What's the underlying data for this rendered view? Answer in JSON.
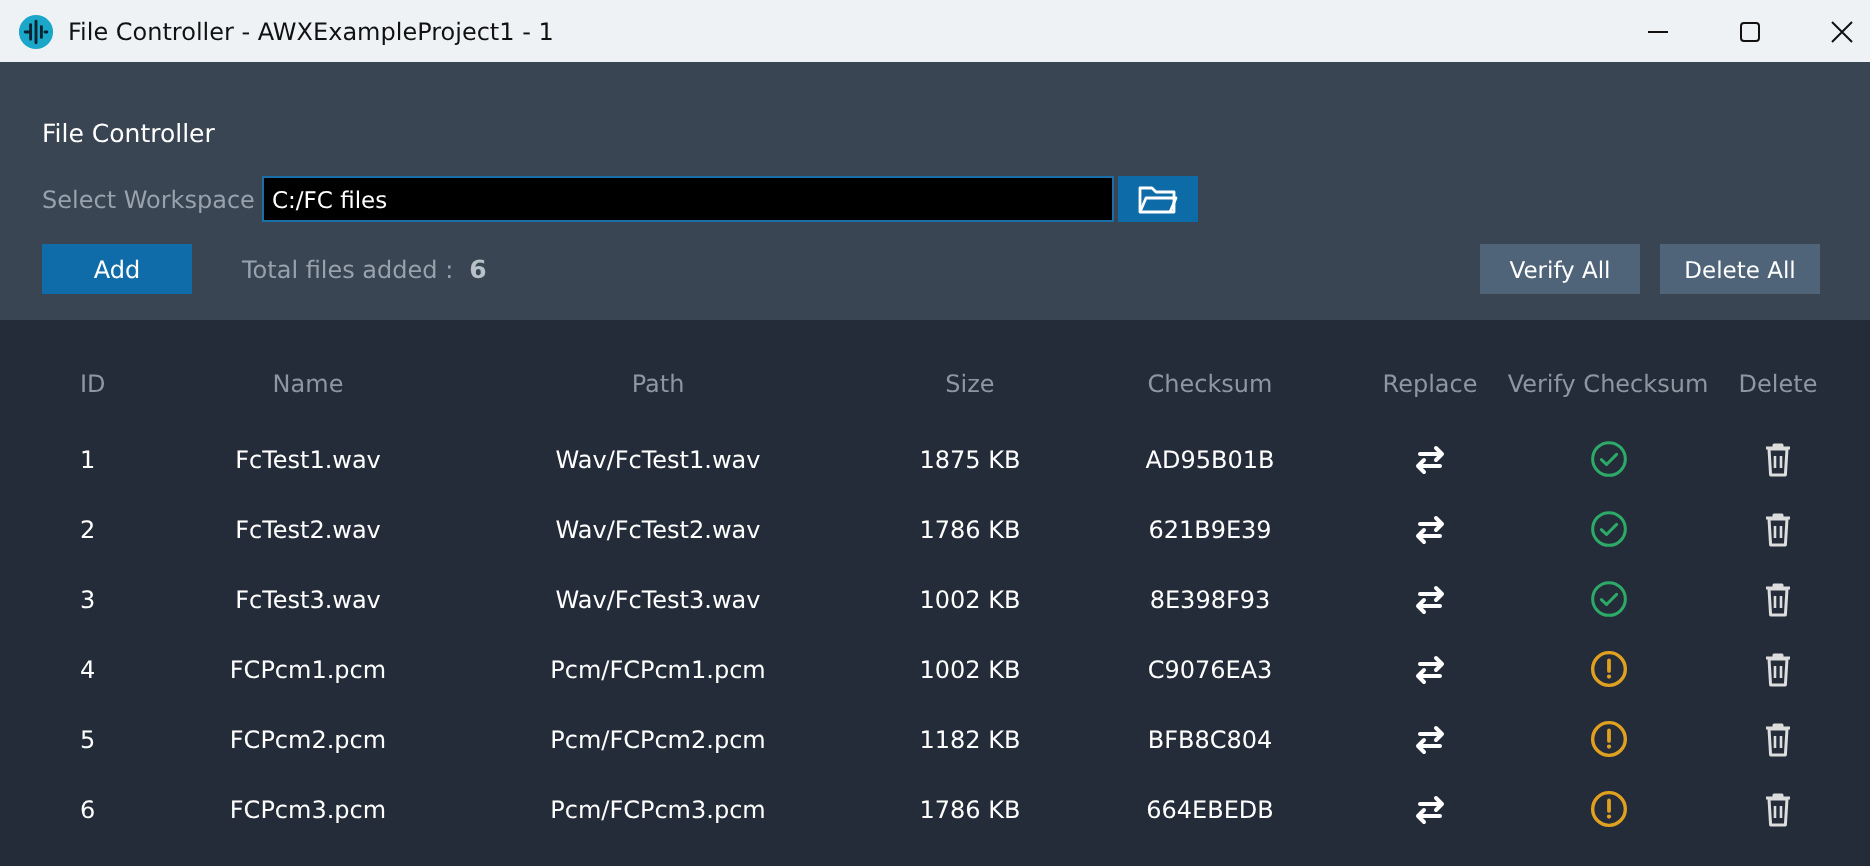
{
  "window": {
    "title": "File Controller - AWXExampleProject1 - 1"
  },
  "panel": {
    "heading": "File Controller",
    "workspace_label": "Select Workspace",
    "workspace_value": "C:/FC files",
    "add_button": "Add",
    "total_label": "Total files added :",
    "total_count": "6",
    "verify_all_button": "Verify All",
    "delete_all_button": "Delete All"
  },
  "table": {
    "columns": [
      "ID",
      "Name",
      "Path",
      "Size",
      "Checksum",
      "Replace",
      "Verify Checksum",
      "Delete"
    ],
    "rows": [
      {
        "id": "1",
        "name": "FcTest1.wav",
        "path": "Wav/FcTest1.wav",
        "size": "1875 KB",
        "checksum": "AD95B01B",
        "verified": true
      },
      {
        "id": "2",
        "name": "FcTest2.wav",
        "path": "Wav/FcTest2.wav",
        "size": "1786 KB",
        "checksum": "621B9E39",
        "verified": true
      },
      {
        "id": "3",
        "name": "FcTest3.wav",
        "path": "Wav/FcTest3.wav",
        "size": "1002 KB",
        "checksum": "8E398F93",
        "verified": true
      },
      {
        "id": "4",
        "name": "FCPcm1.pcm",
        "path": "Pcm/FCPcm1.pcm",
        "size": "1002 KB",
        "checksum": "C9076EA3",
        "verified": false
      },
      {
        "id": "5",
        "name": "FCPcm2.pcm",
        "path": "Pcm/FCPcm2.pcm",
        "size": "1182 KB",
        "checksum": "BFB8C804",
        "verified": false
      },
      {
        "id": "6",
        "name": "FCPcm3.pcm",
        "path": "Pcm/FCPcm3.pcm",
        "size": "1786 KB",
        "checksum": "664EBEDB",
        "verified": false
      }
    ]
  }
}
